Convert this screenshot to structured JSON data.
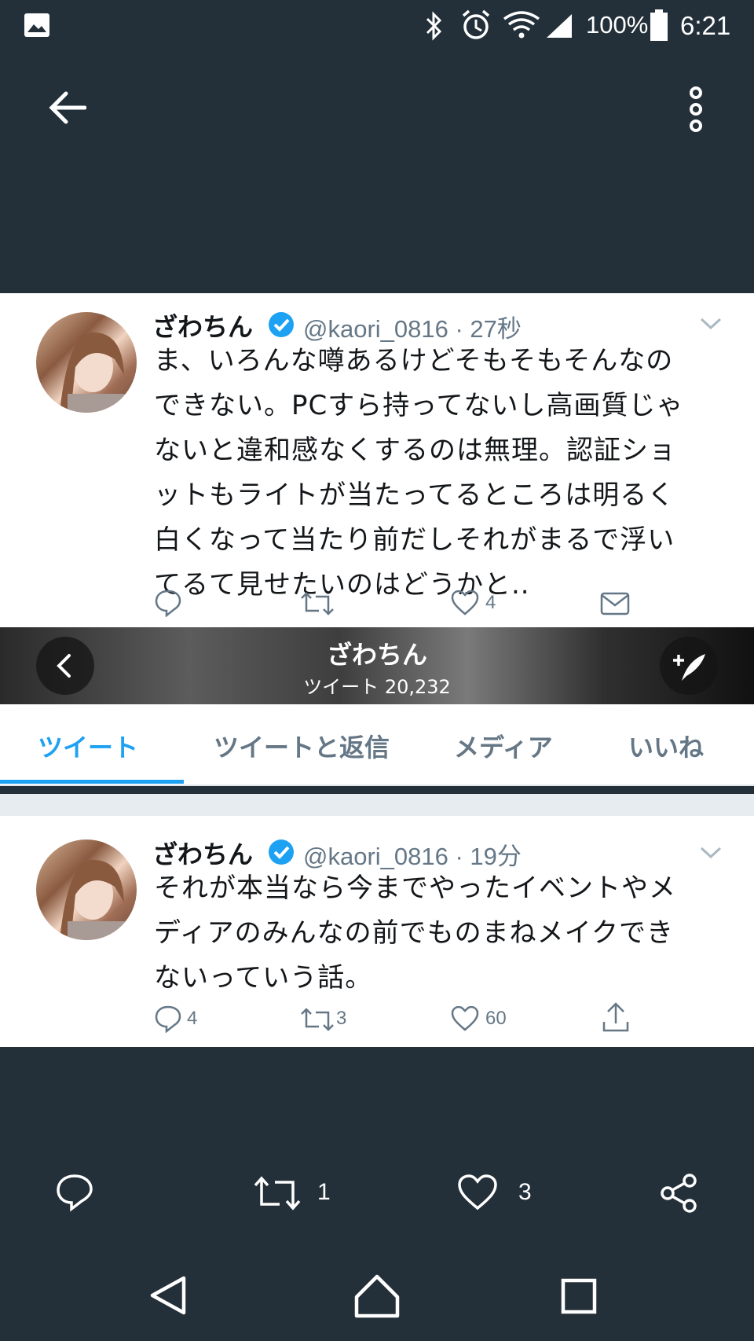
{
  "status_bar": {
    "battery": "100%",
    "time": "6:21"
  },
  "tweet1": {
    "display_name": "ざわちん",
    "handle_time": "@kaori_0816 · 27秒",
    "lines": [
      "ま、いろんな噂あるけどそもそもそんなの",
      "できない。PCすら持ってないし高画質じゃ",
      "ないと違和感なくするのは無理。認証ショ",
      "ットもライトが当たってるところは明るく",
      "白くなって当たり前だしそれがまるで浮い",
      "てるて見せたいのはどうかと.."
    ],
    "like_count": "4"
  },
  "profile": {
    "name": "ざわちん",
    "tweet_count": "ツイート 20,232"
  },
  "tabs": [
    "ツイート",
    "ツイートと返信",
    "メディア",
    "いいね"
  ],
  "tweet2": {
    "display_name": "ざわちん",
    "handle_time": "@kaori_0816 · 19分",
    "lines": [
      "それが本当なら今までやったイベントやメ",
      "ディアのみんなの前でものまねメイクでき",
      "ないっていう話。"
    ],
    "reply_count": "4",
    "retweet_count": "3",
    "like_count": "60"
  },
  "bottom_actions": {
    "retweet_count": "1",
    "like_count": "3"
  },
  "colors": {
    "accent": "#1da1f2",
    "dark_bg": "#243039",
    "verified": "#1da1f2"
  }
}
